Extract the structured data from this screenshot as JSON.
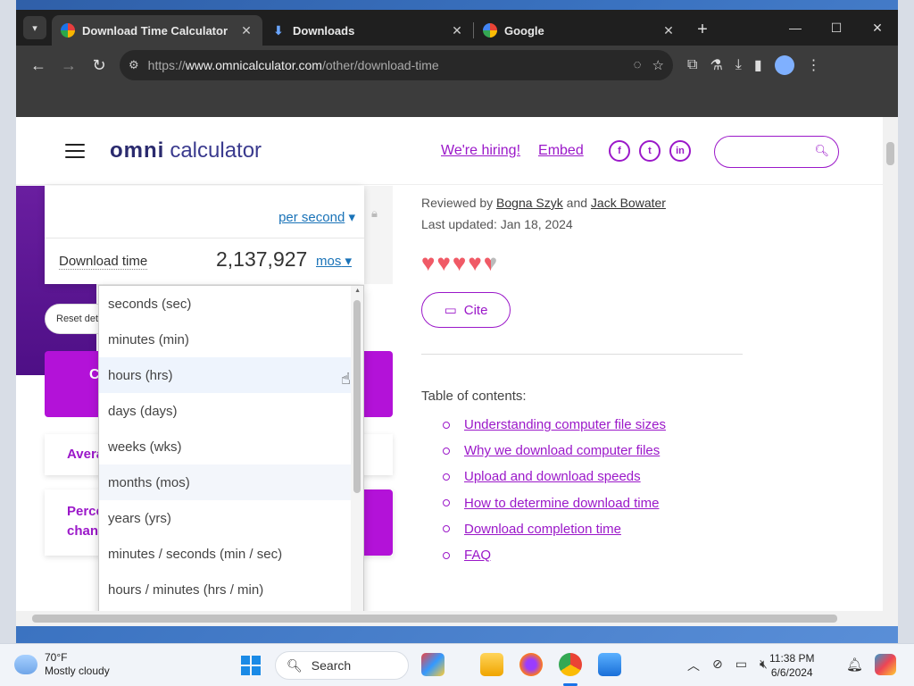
{
  "browser": {
    "tabs": [
      {
        "title": "Download Time Calculator",
        "active": true
      },
      {
        "title": "Downloads",
        "active": false
      },
      {
        "title": "Google",
        "active": false
      }
    ],
    "url_prefix": "https://",
    "url_domain": "www.omnicalculator.com",
    "url_path": "/other/download-time"
  },
  "header": {
    "logo_omni": "omni",
    "logo_calc": "calculator",
    "hiring": "We're hiring!",
    "embed": "Embed",
    "social": [
      "f",
      "t",
      "in"
    ]
  },
  "calculator": {
    "speed_unit": "per second",
    "download_label": "Download time",
    "download_value": "2,137,927",
    "download_unit": "mos",
    "reset_label": "Reset det",
    "purple_btn_label": "C",
    "avg_label": "Avera",
    "pct_label_1": "Perce",
    "pct_label_2": "chan"
  },
  "dropdown": {
    "options": [
      "seconds (sec)",
      "minutes (min)",
      "hours (hrs)",
      "days (days)",
      "weeks (wks)",
      "months (mos)",
      "years (yrs)",
      "minutes / seconds (min / sec)",
      "hours / minutes (hrs / min)"
    ],
    "hovered_index": 2,
    "selected_index": 5
  },
  "article": {
    "reviewed_prefix": "Reviewed by",
    "reviewer_1": "Bogna Szyk",
    "and": "and",
    "reviewer_2": "Jack Bowater",
    "updated": "Last updated: Jan 18, 2024",
    "rating": 4.5,
    "cite": "Cite",
    "toc_title": "Table of contents:",
    "toc": [
      "Understanding computer file sizes",
      "Why we download computer files",
      "Upload and download speeds",
      "How to determine download time",
      "Download completion time",
      "FAQ"
    ]
  },
  "taskbar": {
    "temp": "70°F",
    "weather": "Mostly cloudy",
    "search": "Search",
    "time": "11:38 PM",
    "date": "6/6/2024"
  },
  "colors": {
    "brand_purple": "#9b18c9",
    "button_purple": "#b312d8",
    "heart": "#f05a66"
  }
}
